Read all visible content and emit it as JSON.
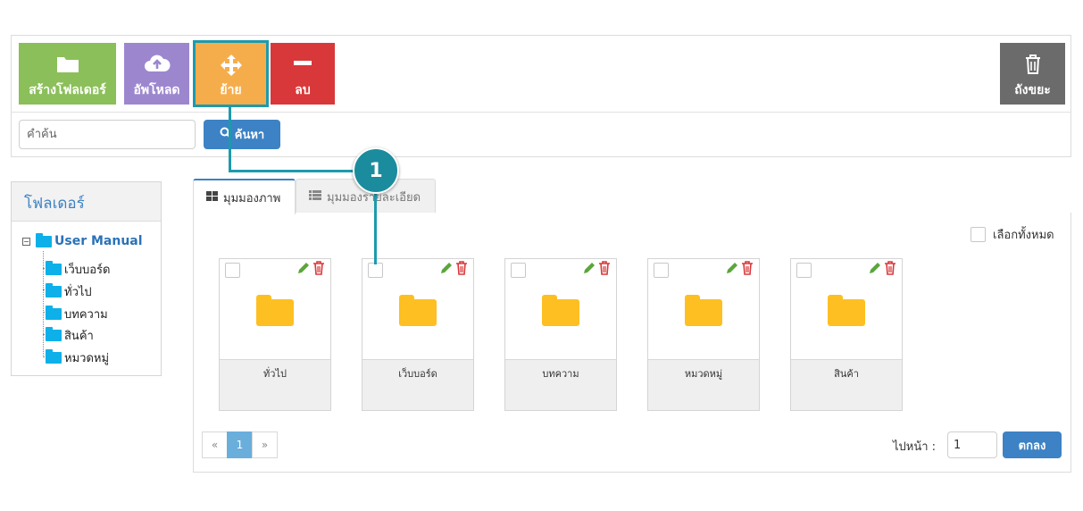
{
  "toolbar": {
    "create_folder": "สร้างโฟลเดอร์",
    "upload": "อัพโหลด",
    "move": "ย้าย",
    "delete": "ลบ",
    "trash": "ถังขยะ"
  },
  "search": {
    "placeholder": "คำค้น",
    "button_label": "ค้นหา"
  },
  "tree": {
    "header": "โฟลเดอร์",
    "root": "User Manual",
    "children": [
      "เว็บบอร์ด",
      "ทั่วไป",
      "บทความ",
      "สินค้า",
      "หมวดหมู่"
    ]
  },
  "tabs": {
    "grid_view": "มุมมองภาพ",
    "detail_view": "มุมมองรายละเอียด"
  },
  "select_all_label": "เลือกทั้งหมด",
  "folders": [
    "ทั่วไป",
    "เว็บบอร์ด",
    "บทความ",
    "หมวดหมู่",
    "สินค้า"
  ],
  "pagination": {
    "prev": "«",
    "current": "1",
    "next": "»",
    "goto_label": "ไปหน้า :",
    "goto_value": "1",
    "goto_button": "ตกลง"
  },
  "annotation": {
    "number": "1"
  },
  "colors": {
    "create": "#8bbf5a",
    "upload": "#9c87cf",
    "move": "#f5ad4c",
    "delete": "#d9383a",
    "trash": "#6b6b6b",
    "primary": "#3c82c5",
    "folder": "#fdbf22",
    "tree_folder": "#0db0e8",
    "highlight": "#1d9aad"
  },
  "icons": {
    "create": "folder-icon",
    "upload": "cloud-upload-icon",
    "move": "move-arrows-icon",
    "delete": "minus-icon",
    "trash": "trash-icon",
    "search": "search-icon",
    "grid": "grid-icon",
    "list": "list-icon",
    "edit": "pencil-icon",
    "remove": "trash-icon"
  }
}
